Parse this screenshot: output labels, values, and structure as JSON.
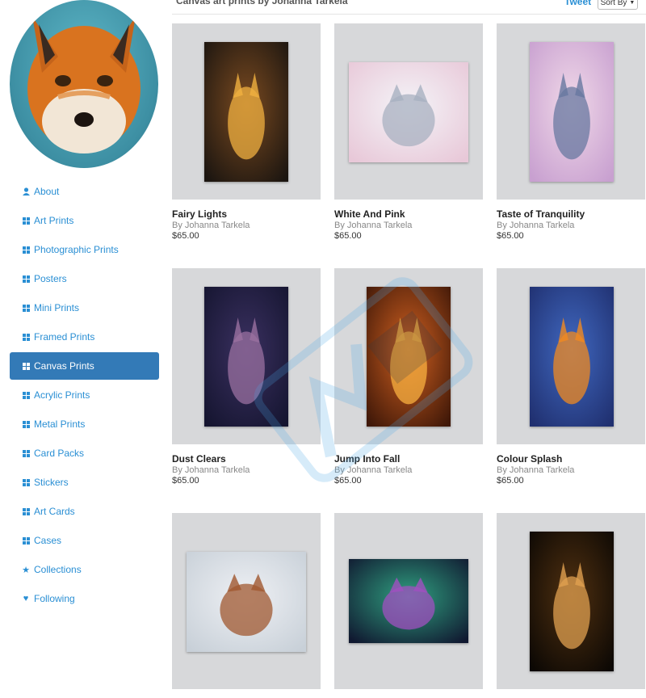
{
  "header": {
    "title": "Canvas art prints by Johanna Tarkela",
    "tweet_label": "Tweet",
    "sort_label": "Sort By"
  },
  "avatar": {
    "icon": "fox-portrait"
  },
  "sidebar": {
    "items": [
      {
        "label": "About",
        "icon": "user-icon",
        "active": false
      },
      {
        "label": "Art Prints",
        "icon": "grid-icon",
        "active": false
      },
      {
        "label": "Photographic Prints",
        "icon": "grid-icon",
        "active": false
      },
      {
        "label": "Posters",
        "icon": "grid-icon",
        "active": false
      },
      {
        "label": "Mini Prints",
        "icon": "grid-icon",
        "active": false
      },
      {
        "label": "Framed Prints",
        "icon": "grid-icon",
        "active": false
      },
      {
        "label": "Canvas Prints",
        "icon": "grid-icon",
        "active": true
      },
      {
        "label": "Acrylic Prints",
        "icon": "grid-icon",
        "active": false
      },
      {
        "label": "Metal Prints",
        "icon": "grid-icon",
        "active": false
      },
      {
        "label": "Card Packs",
        "icon": "grid-icon",
        "active": false
      },
      {
        "label": "Stickers",
        "icon": "grid-icon",
        "active": false
      },
      {
        "label": "Art Cards",
        "icon": "grid-icon",
        "active": false
      },
      {
        "label": "Cases",
        "icon": "grid-icon",
        "active": false
      },
      {
        "label": "Collections",
        "icon": "star-icon",
        "active": false
      },
      {
        "label": "Following",
        "icon": "heart-icon",
        "active": false
      }
    ]
  },
  "products": [
    {
      "title": "Fairy Lights",
      "by": "By Johanna Tarkela",
      "price": "$65.00"
    },
    {
      "title": "White And Pink",
      "by": "By Johanna Tarkela",
      "price": "$65.00"
    },
    {
      "title": "Taste of Tranquility",
      "by": "By Johanna Tarkela",
      "price": "$65.00"
    },
    {
      "title": "Dust Clears",
      "by": "By Johanna Tarkela",
      "price": "$65.00"
    },
    {
      "title": "Jump Into Fall",
      "by": "By Johanna Tarkela",
      "price": "$65.00"
    },
    {
      "title": "Colour Splash",
      "by": "By Johanna Tarkela",
      "price": "$65.00"
    },
    {
      "title": "",
      "by": "",
      "price": ""
    },
    {
      "title": "",
      "by": "",
      "price": ""
    },
    {
      "title": "",
      "by": "",
      "price": ""
    }
  ],
  "colors": {
    "accent": "#337ab7",
    "link": "#2a8fd4",
    "frame": "#d7d8da"
  }
}
